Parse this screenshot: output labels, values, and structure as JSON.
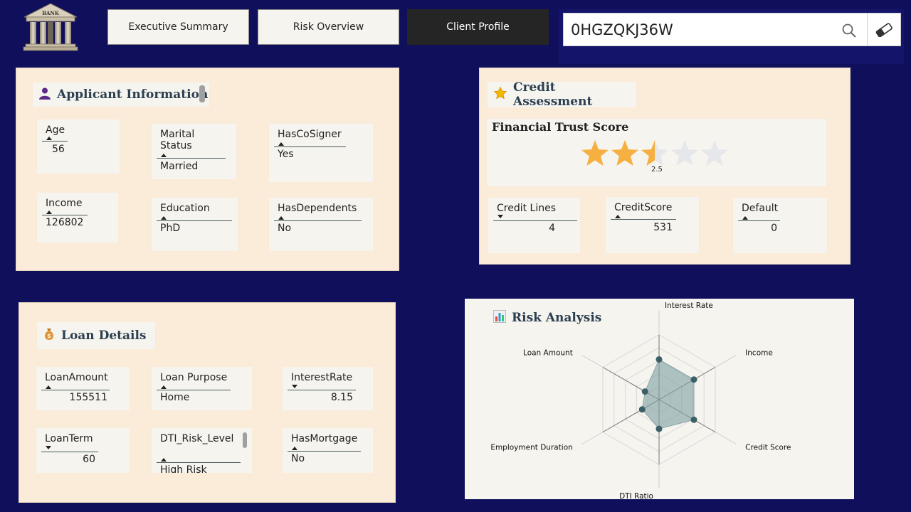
{
  "header": {
    "logo_text": "BANK",
    "tabs": [
      {
        "label": "Executive Summary",
        "active": false
      },
      {
        "label": "Risk Overview",
        "active": false
      },
      {
        "label": "Client Profile",
        "active": true
      }
    ],
    "search": {
      "value": "0HGZQKJ36W",
      "placeholder": ""
    }
  },
  "applicant": {
    "title": "Applicant Information",
    "icon": "person-icon",
    "fields": {
      "age": {
        "label": "Age",
        "value": "56"
      },
      "marital": {
        "label": "Marital Status",
        "value": "Married"
      },
      "cosigner": {
        "label": "HasCoSigner",
        "value": "Yes"
      },
      "income": {
        "label": "Income",
        "value": "126802"
      },
      "education": {
        "label": "Education",
        "value": "PhD"
      },
      "dependents": {
        "label": "HasDependents",
        "value": "No"
      }
    }
  },
  "credit": {
    "title": "Credit Assessment",
    "icon": "star-icon",
    "score_title": "Financial Trust Score",
    "rating": 2.5,
    "rating_max": 5,
    "rating_label": "2.5",
    "fields": {
      "lines": {
        "label": "Credit Lines",
        "value": "4"
      },
      "score": {
        "label": "CreditScore",
        "value": "531"
      },
      "default": {
        "label": "Default",
        "value": "0"
      }
    }
  },
  "loan": {
    "title": "Loan Details",
    "icon": "money-bag-icon",
    "fields": {
      "amount": {
        "label": "LoanAmount",
        "value": "155511"
      },
      "purpose": {
        "label": "Loan Purpose",
        "value": "Home"
      },
      "rate": {
        "label": "InterestRate",
        "value": "8.15"
      },
      "term": {
        "label": "LoanTerm",
        "value": "60"
      },
      "dti": {
        "label": "DTI_Risk_Level",
        "value": "High Risk"
      },
      "mortgage": {
        "label": "HasMortgage",
        "value": "No"
      }
    }
  },
  "risk": {
    "title": "Risk Analysis",
    "icon": "bar-chart-icon"
  },
  "colors": {
    "background": "#0f0f5c",
    "panel": "#fbebd9",
    "card": "#f6f4ee",
    "star_filled": "#f5b041",
    "star_empty": "#e5e7eb",
    "radar_fill": "#7f9fa3",
    "radar_point": "#3d5f68"
  },
  "chart_data": {
    "type": "radar",
    "axes": [
      "Interest Rate",
      "Income",
      "Credit Score",
      "DTI Ratio",
      "Employment Duration",
      "Loan Amount"
    ],
    "values": [
      0.62,
      0.62,
      0.62,
      0.45,
      0.3,
      0.25
    ],
    "range": [
      0,
      1
    ],
    "grid_levels": 5
  }
}
